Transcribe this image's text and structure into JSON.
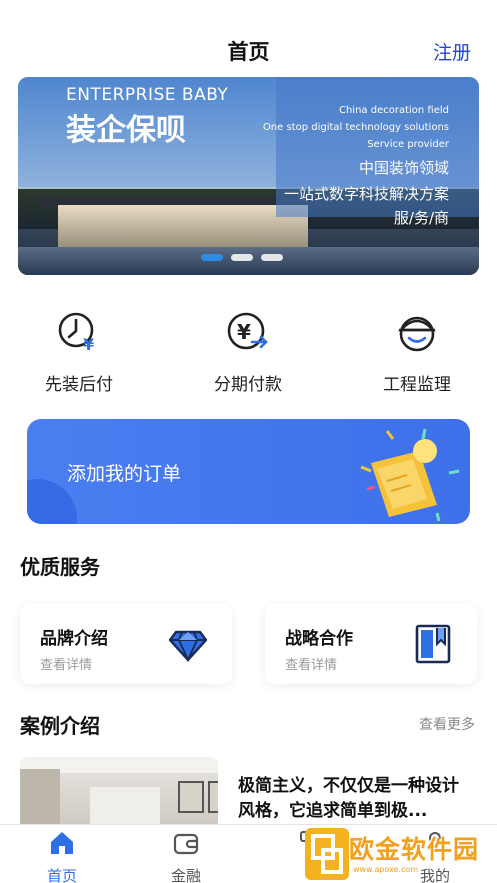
{
  "header": {
    "title": "首页",
    "register": "注册"
  },
  "banner": {
    "english_title": "ENTERPRISE BABY",
    "chinese_title": "装企保呗",
    "lines": [
      "China decoration field",
      "One stop digital technology solutions",
      "Service provider",
      "中国装饰领域",
      "一站式数字科技解决方案",
      "服/务/商"
    ],
    "slides": 3,
    "active_slide": 1
  },
  "features": [
    {
      "label": "先装后付",
      "icon": "clock-yuan-icon"
    },
    {
      "label": "分期付款",
      "icon": "yuan-arrow-icon"
    },
    {
      "label": "工程监理",
      "icon": "hardhat-worker-icon"
    }
  ],
  "order": {
    "label": "添加我的订单"
  },
  "services": {
    "title": "优质服务",
    "cards": [
      {
        "name": "品牌介绍",
        "sub": "查看详情",
        "icon": "diamond-icon"
      },
      {
        "name": "战略合作",
        "sub": "查看详情",
        "icon": "book-bookmark-icon"
      }
    ]
  },
  "cases": {
    "title": "案例介绍",
    "more": "查看更多",
    "item_text": "极简主义，不仅仅是一种设计风格，它追求简单到极..."
  },
  "tabbar": {
    "items": [
      {
        "label": "首页",
        "icon": "home-icon",
        "active": true
      },
      {
        "label": "金融",
        "icon": "wallet-icon",
        "active": false
      },
      {
        "label": "",
        "icon": "grid-icon",
        "active": false
      },
      {
        "label": "我的",
        "icon": "user-icon",
        "active": false
      }
    ]
  },
  "watermark": {
    "text": "欧金软件园",
    "url": "www.apoxe.com"
  },
  "colors": {
    "accent": "#2f6fe6",
    "register": "#2147d8",
    "card_blue": "#4a7ef0"
  }
}
